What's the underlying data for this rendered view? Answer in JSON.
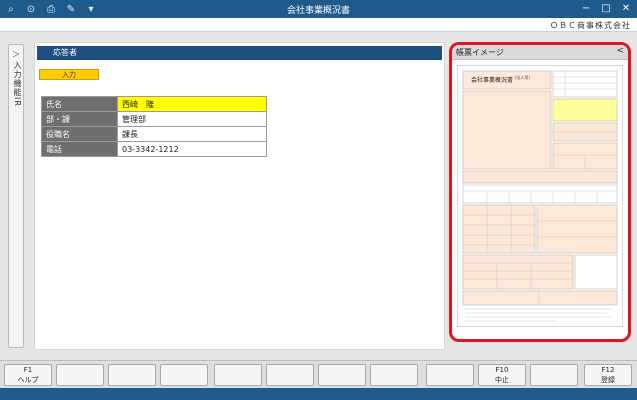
{
  "window": {
    "title": "会社事業概況書",
    "company": "ＯＢＣ商事株式会社",
    "icons": [
      "search-plus-icon",
      "zoom-icon",
      "print-icon",
      "wrench-icon",
      "dropdown-arrow-icon"
    ],
    "controls": {
      "minimize": "−",
      "maximize": "□",
      "close": "✕"
    }
  },
  "sidetab": {
    "chevron": "＞",
    "label": "入力機能IR"
  },
  "main": {
    "section_title": "応答者",
    "input_badge": "入力",
    "fields": [
      {
        "label": "氏名",
        "value": "西崎　隆",
        "highlight": true
      },
      {
        "label": "部・課",
        "value": "管理部",
        "highlight": false
      },
      {
        "label": "役職名",
        "value": "課長",
        "highlight": false
      },
      {
        "label": "電話",
        "value": "03-3342-1212",
        "highlight": false
      }
    ]
  },
  "preview": {
    "title": "帳票イメージ",
    "collapse": "<",
    "doc_title": "会社事業概況書",
    "doc_subtitle": "(法人用)"
  },
  "fkeys": [
    {
      "code": "F1",
      "label": "ヘルプ"
    },
    {
      "code": "",
      "label": ""
    },
    {
      "code": "",
      "label": ""
    },
    {
      "code": "",
      "label": ""
    },
    {
      "code": "",
      "label": ""
    },
    {
      "code": "",
      "label": ""
    },
    {
      "code": "",
      "label": ""
    },
    {
      "code": "",
      "label": ""
    },
    {
      "code": "",
      "label": ""
    },
    {
      "code": "F10",
      "label": "中止"
    },
    {
      "code": "",
      "label": ""
    },
    {
      "code": "F12",
      "label": "登録"
    }
  ],
  "colors": {
    "titlebar": "#1f5a8c",
    "section_header": "#1f4f80",
    "highlight": "#ffff00",
    "badge": "#ffcc00",
    "preview_border": "#e0141e"
  }
}
